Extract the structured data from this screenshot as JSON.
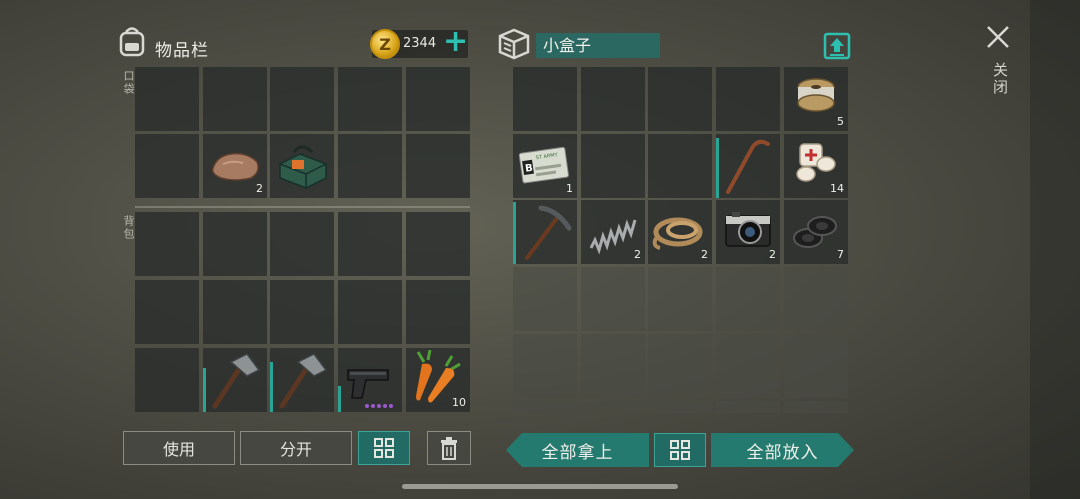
{
  "inventory": {
    "title": "物品栏",
    "pocket_label": "口袋",
    "backpack_label": "背包",
    "coins": "2344",
    "items": {
      "stone_qty": "2",
      "carrot_qty": "10"
    }
  },
  "container": {
    "name": "小盒子",
    "items": {
      "wire_qty": "5",
      "id_card_qty": "1",
      "bandage_qty": "14",
      "spring_qty": "2",
      "rope_qty": "2",
      "camera_qty": "2",
      "tape_qty": "7"
    },
    "id_card_text": "ST ARMY"
  },
  "buttons": {
    "use": "使用",
    "split": "分开",
    "take_all": "全部拿上",
    "put_all": "全部放入"
  },
  "close_label": "关闭",
  "colors": {
    "accent": "#2aa595",
    "coin": "#d8a418"
  }
}
